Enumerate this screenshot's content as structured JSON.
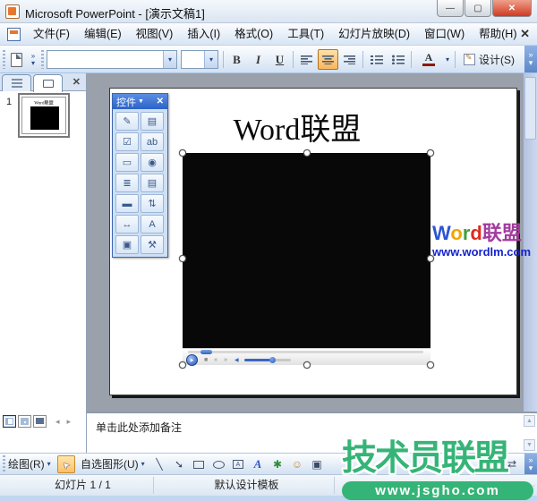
{
  "window": {
    "title": "Microsoft PowerPoint - [演示文稿1]",
    "controls": {
      "minimize": "—",
      "maximize": "▢",
      "close": "✕"
    }
  },
  "menu_bar": {
    "items": [
      "文件(F)",
      "编辑(E)",
      "视图(V)",
      "插入(I)",
      "格式(O)",
      "工具(T)",
      "幻灯片放映(D)",
      "窗口(W)",
      "帮助(H)"
    ],
    "close_glyph": "✕"
  },
  "toolbar": {
    "font_name_value": "",
    "font_size_value": "",
    "bold": "B",
    "italic": "I",
    "underline": "U",
    "font_color_letter": "A",
    "design_label": "设计(S)",
    "overflow_glyph": "»",
    "dropdown_glyph": "▾"
  },
  "slides_panel": {
    "slide_number": "1",
    "thumbnail_title": "Word联盟",
    "close_glyph": "✕"
  },
  "control_toolbox": {
    "title": "控件",
    "dropdown_glyph": "▼",
    "close_glyph": "✕",
    "buttons": {
      "design_mode": "✎",
      "properties": "▤",
      "checkbox": "☑",
      "textbox": "ab",
      "command_button": "▭",
      "option_button": "◉",
      "listbox": "≣",
      "combobox": "▤",
      "toggle_button": "▬",
      "spin_button": "⇅",
      "scrollbar": "↔",
      "label": "A",
      "image": "▣",
      "more_controls": "⚒"
    }
  },
  "slide": {
    "title": "Word联盟"
  },
  "media_player": {
    "play": "▶",
    "stop": "■",
    "previous": "«",
    "next": "»",
    "volume_glyph": "◀"
  },
  "wordlm_watermark": {
    "w": "W",
    "o": "o",
    "r": "r",
    "d": "d",
    "cn": "联盟",
    "url": "www.wordlm.com"
  },
  "notes": {
    "placeholder": "单击此处添加备注"
  },
  "drawing_toolbar": {
    "draw_label": "绘图(R)",
    "autoshapes_label": "自选图形(U)",
    "pointer_glyph": "➤",
    "line_glyph": "╲",
    "arrow_glyph": "➘",
    "textbox_glyph": "A",
    "wordart_glyph": "A",
    "diagram_glyph": "✱",
    "clipart_glyph": "☺",
    "picture_glyph": "▣",
    "swap_glyph": "⇄",
    "overflow_glyph": "»",
    "dropdown_glyph": "▾"
  },
  "status_bar": {
    "slide_indicator": "幻灯片 1 / 1",
    "design_template": "默认设计模板"
  },
  "jsgho_watermark": {
    "title": "技术员联盟",
    "url": "www.jsgho.com"
  },
  "ui": {
    "up": "▲",
    "down": "▼",
    "left": "◂",
    "right": "▸"
  },
  "colors": {
    "selection_orange": "#f9b65c",
    "toolbox_titlebar_blue": "#2c62c8",
    "workspace_gray": "#9aa1ab",
    "watermark_green": "#35b477",
    "wordlm_w": "#2e54d2",
    "wordlm_o": "#f0a500",
    "wordlm_r": "#3f9f3a",
    "wordlm_d": "#e02a1e",
    "wordlm_cn": "#a23c9e",
    "wordlm_url": "#1423cc",
    "close_button_red": "#cf3a22"
  }
}
